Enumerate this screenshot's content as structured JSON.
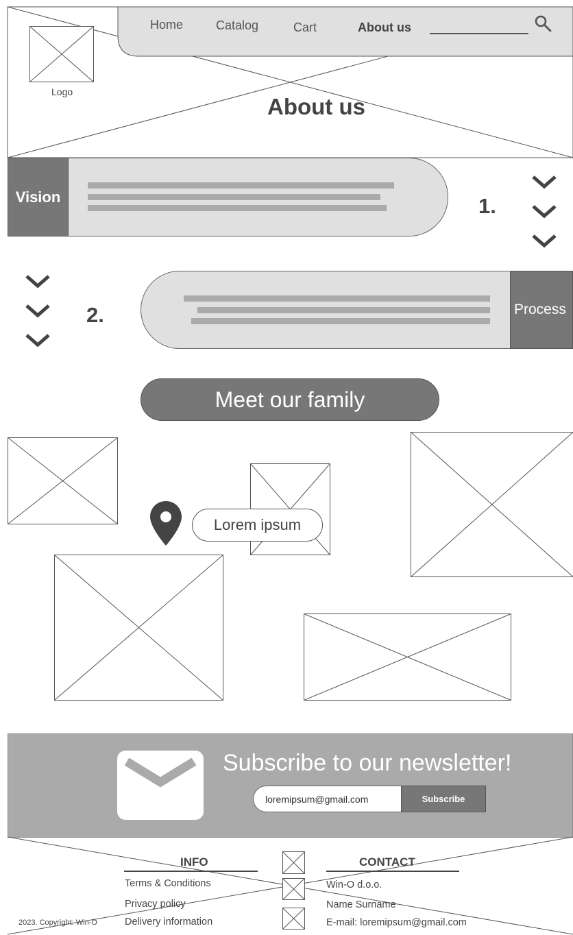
{
  "header": {
    "logo_label": "Logo",
    "nav": [
      {
        "label": "Home",
        "active": false
      },
      {
        "label": "Catalog",
        "active": false
      },
      {
        "label": "Cart",
        "active": false
      },
      {
        "label": "About us",
        "active": true
      }
    ],
    "search_icon": "search-icon",
    "page_title": "About us"
  },
  "sections": {
    "vision": {
      "label": "Vision",
      "number": "1."
    },
    "process": {
      "label": "Process",
      "number": "2."
    },
    "chevron_icon": "chevron-down-icon"
  },
  "family": {
    "button_label": "Meet our family",
    "location_icon": "map-pin-icon",
    "bubble_text": "Lorem ipsum"
  },
  "newsletter": {
    "title": "Subscribe to our newsletter!",
    "email_value": "loremipsum@gmail.com",
    "button_label": "Subscribe",
    "mail_icon": "envelope-icon"
  },
  "footer": {
    "info_heading": "INFO",
    "info_items": [
      "Terms & Conditions",
      "Privacy policy",
      "Delivery information"
    ],
    "contact_heading": "CONTACT",
    "contact_items": [
      "Win-O d.o.o.",
      "Name Surname",
      "E-mail: loremipsum@gmail.com"
    ],
    "copyright": "2023. Copyright: Win-O"
  },
  "colors": {
    "dark_gray": "#777777",
    "light_gray": "#e0e0e0",
    "newsletter_bg": "#aaaaaa",
    "text": "#444444"
  }
}
